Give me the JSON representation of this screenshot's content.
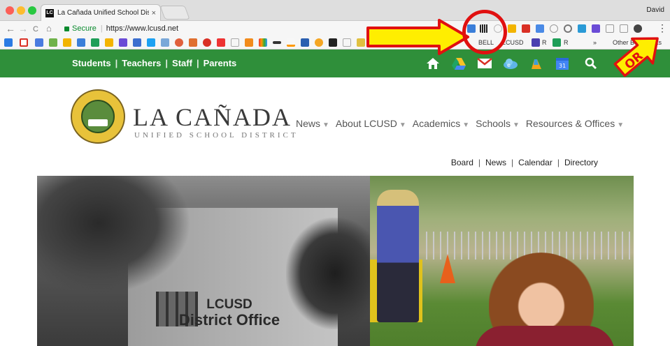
{
  "browser": {
    "tab_title": "La Cañada Unified School Dist",
    "tab_favicon": "LC",
    "tab_close": "×",
    "profile_name": "David",
    "nav_back": "←",
    "nav_forward": "→",
    "nav_reload": "C",
    "nav_home": "⌂",
    "secure_label": "Secure",
    "url": "https://www.lcusd.net",
    "bookmarks": [
      "BELL",
      "LCUSD",
      "R",
      "R"
    ],
    "other_bookmarks": "Other Bookmarks",
    "overflow": "»",
    "menu_icon": "⋮"
  },
  "greenbar": {
    "links": [
      "Students",
      "Teachers",
      "Staff",
      "Parents"
    ]
  },
  "site": {
    "brand_title": "LA CAÑADA",
    "brand_subtitle": "UNIFIED SCHOOL DISTRICT",
    "nav": [
      "News",
      "About LCUSD",
      "Academics",
      "Schools",
      "Resources & Offices"
    ],
    "subnav": [
      "Board",
      "News",
      "Calendar",
      "Directory"
    ],
    "hero_sign_line1": "LCUSD",
    "hero_sign_line2": "District Office"
  },
  "annotation": {
    "or_label": "OR"
  },
  "colors": {
    "green_bar": "#2f8f3a",
    "arrow_yellow": "#ffee00",
    "annotation_red": "#e01010"
  }
}
